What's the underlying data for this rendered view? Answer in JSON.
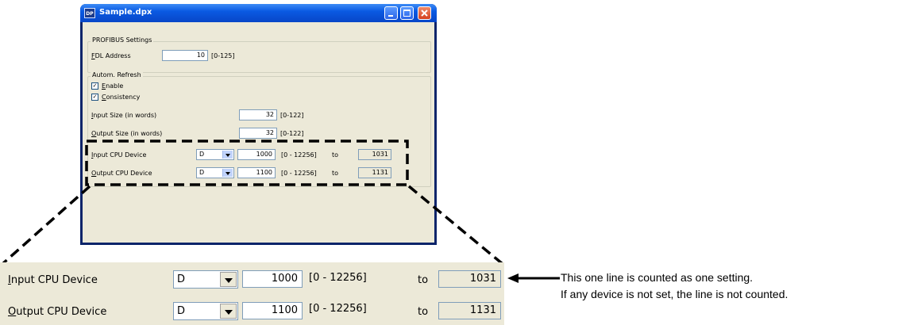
{
  "window": {
    "title": "Sample.dpx",
    "icon_text": "DP",
    "buttons": {
      "minimize": "minimize-icon",
      "maximize": "maximize-icon",
      "close": "close-icon"
    }
  },
  "profibus": {
    "legend": "PROFIBUS Settings",
    "fdl_label_accel": "F",
    "fdl_label_rest": "DL Address",
    "fdl_value": "10",
    "fdl_range": "[0-125]"
  },
  "refresh": {
    "legend": "Autom. Refresh",
    "enable_accel": "E",
    "enable_rest": "nable",
    "enable_checked": true,
    "consistency_accel": "C",
    "consistency_rest": "onsistency",
    "consistency_checked": true,
    "input_size_accel": "I",
    "input_size_rest": "nput Size (in words)",
    "input_size_value": "32",
    "input_size_range": "[0-122]",
    "output_size_accel": "O",
    "output_size_rest": "utput Size (in words)",
    "output_size_value": "32",
    "output_size_range": "[0-122]"
  },
  "devices": [
    {
      "label_accel": "I",
      "label_rest": "nput CPU Device",
      "device": "D",
      "start": "1000",
      "range": "[0 - 12256]",
      "to_label": "to",
      "end": "1031"
    },
    {
      "label_accel": "O",
      "label_rest": "utput CPU Device",
      "device": "D",
      "start": "1100",
      "range": "[0 - 12256]",
      "to_label": "to",
      "end": "1131"
    }
  ],
  "annotation": {
    "line1": "This one line is counted as one setting.",
    "line2": "If any device is not set, the line is not counted."
  },
  "colors": {
    "titlebar": "#0a5ae2",
    "dialog_bg": "#ece9d8",
    "callout_dash": "#000000"
  }
}
